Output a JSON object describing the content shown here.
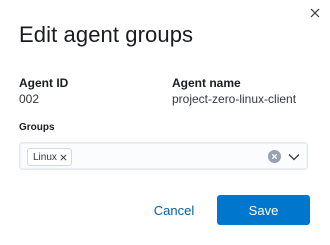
{
  "modal": {
    "title": "Edit agent groups",
    "close_icon": "close-icon"
  },
  "agent": {
    "id_label": "Agent ID",
    "id_value": "002",
    "name_label": "Agent name",
    "name_value": "project-zero-linux-client"
  },
  "groups": {
    "label": "Groups",
    "selected": [
      "Linux"
    ],
    "remove_icon": "close-icon",
    "clear_icon": "clear-icon",
    "dropdown_icon": "chevron-down-icon"
  },
  "actions": {
    "cancel_label": "Cancel",
    "save_label": "Save"
  },
  "colors": {
    "primary": "#0077cc",
    "link": "#0061a6",
    "text": "#343741",
    "heading": "#1a1c21",
    "clear_icon": "#98a2b3"
  }
}
